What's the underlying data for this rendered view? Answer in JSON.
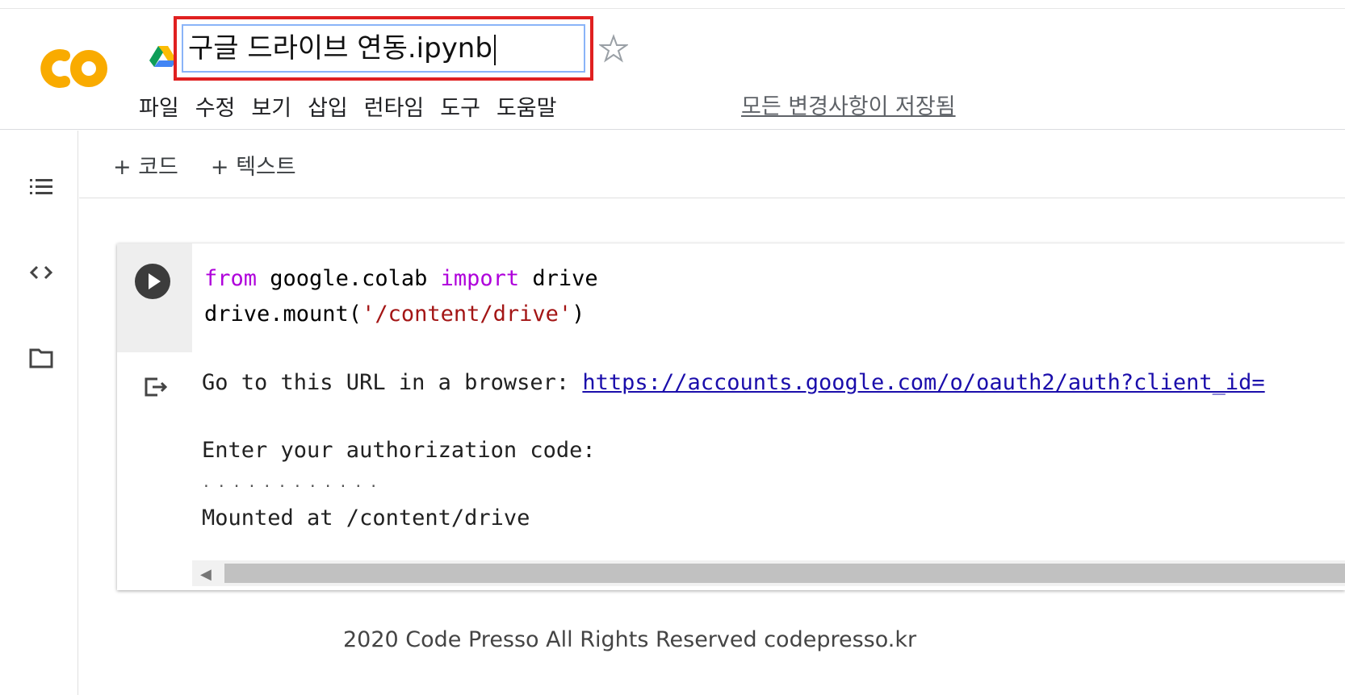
{
  "notebook": {
    "title": "구글 드라이브 연동.ipynb",
    "save_status": "모든 변경사항이 저장됨"
  },
  "menu": {
    "items": [
      "파일",
      "수정",
      "보기",
      "삽입",
      "런타임",
      "도구",
      "도움말"
    ]
  },
  "toolbar": {
    "add_code": "+ 코드",
    "add_text": "+ 텍스트"
  },
  "cell": {
    "code": {
      "line1_kw1": "from",
      "line1_mid": " google.colab ",
      "line1_kw2": "import",
      "line1_end": " drive",
      "line2_start": "drive.mount(",
      "line2_str": "'/content/drive'",
      "line2_end": ")"
    },
    "output": {
      "line1_prefix": "Go to this URL in a browser: ",
      "line1_link": "https://accounts.google.com/o/oauth2/auth?client_id=",
      "line2": "Enter your authorization code:",
      "dots": "············",
      "line3": "Mounted at /content/drive"
    }
  },
  "footer": {
    "text": "2020 Code Presso All Rights Reserved codepresso.kr"
  },
  "colors": {
    "logo_orange": "#f9ab00",
    "highlight_red": "#e02020",
    "keyword": "#af00db",
    "string": "#a31515",
    "link": "#1a0dab"
  },
  "icons": [
    "colab-logo",
    "drive-icon",
    "star-icon",
    "table-of-contents-icon",
    "code-snippets-icon",
    "files-folder-icon",
    "run-cell-icon",
    "output-icon"
  ]
}
